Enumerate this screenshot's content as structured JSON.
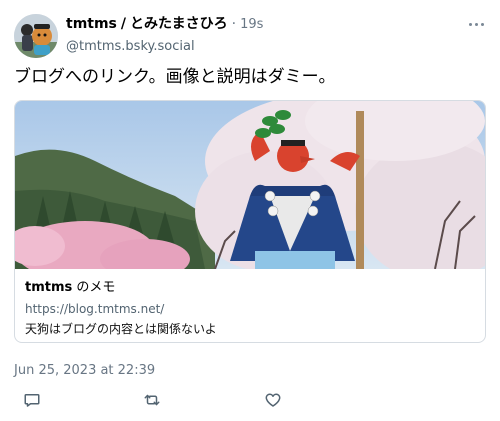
{
  "author": {
    "display_name": "tmtms",
    "separator": "/",
    "japanese_name": "とみたまさひろ",
    "dot": "·",
    "age": "19s",
    "handle": "@tmtms.bsky.social"
  },
  "post": {
    "text": "ブログへのリンク。画像と説明はダミー。",
    "timestamp": "Jun 25, 2023 at 22:39"
  },
  "link_card": {
    "title_bold": "tmtms",
    "title_rest": " のメモ",
    "url": "https://blog.tmtms.net/",
    "description": "天狗はブログの内容とは関係ないよ"
  },
  "icons": {
    "avatar": "avatar-photo",
    "more": "more-options-icon",
    "reply": "reply-icon",
    "repost": "repost-icon",
    "like": "heart-icon"
  },
  "colors": {
    "muted": "#687684",
    "border": "#d6dce2"
  }
}
